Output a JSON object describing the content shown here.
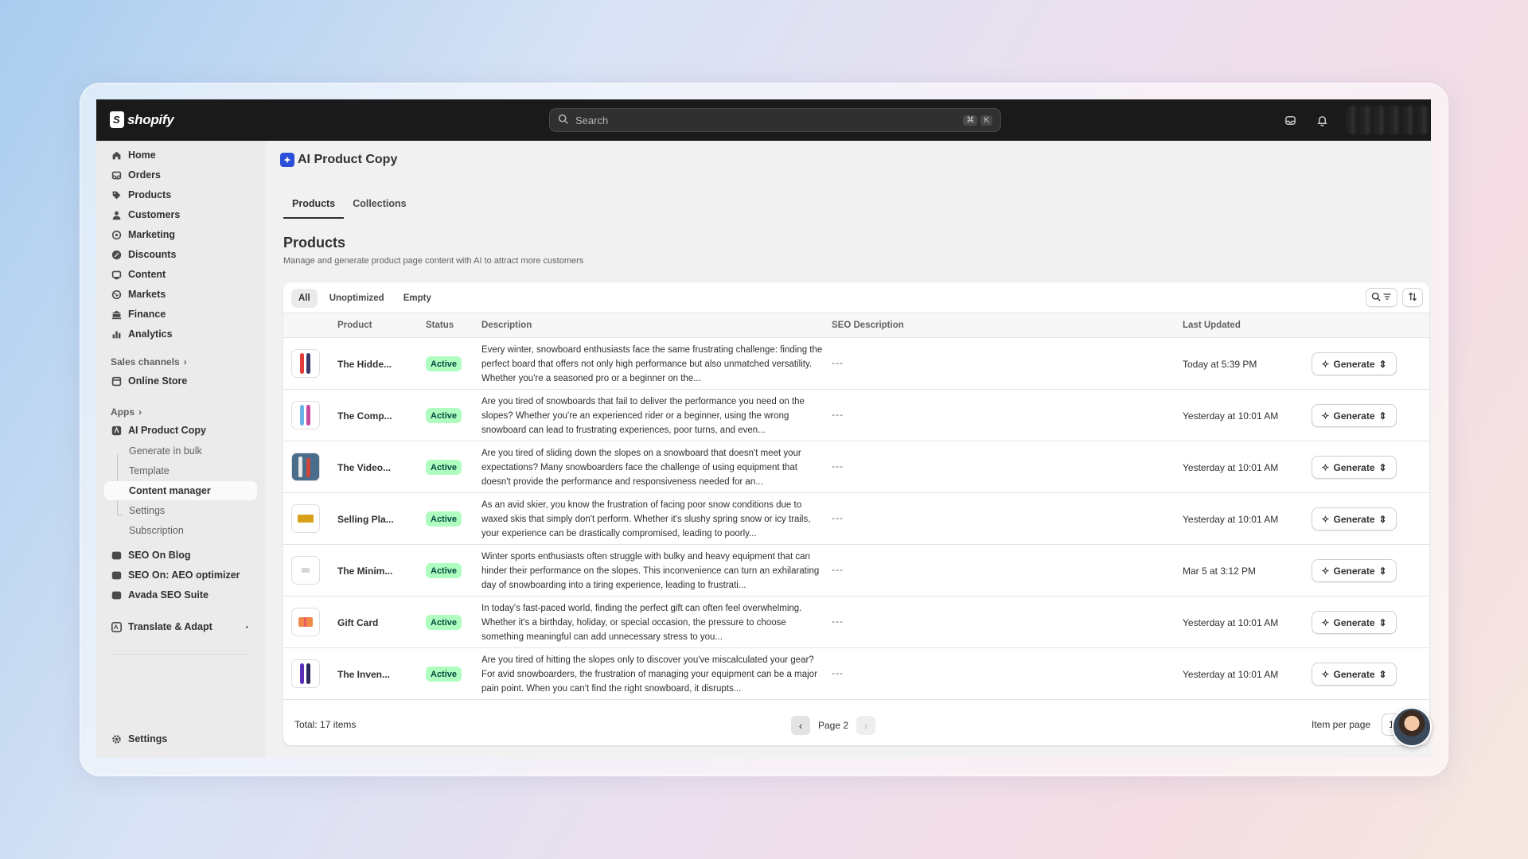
{
  "topbar": {
    "brand": "shopify",
    "search_placeholder": "Search",
    "shortcut_keys": [
      "⌘",
      "K"
    ]
  },
  "sidebar": {
    "items": [
      {
        "label": "Home",
        "icon": "home-icon"
      },
      {
        "label": "Orders",
        "icon": "orders-icon"
      },
      {
        "label": "Products",
        "icon": "tag-icon"
      },
      {
        "label": "Customers",
        "icon": "person-icon"
      },
      {
        "label": "Marketing",
        "icon": "target-icon"
      },
      {
        "label": "Discounts",
        "icon": "discount-icon"
      },
      {
        "label": "Content",
        "icon": "content-icon"
      },
      {
        "label": "Markets",
        "icon": "globe-icon"
      },
      {
        "label": "Finance",
        "icon": "bank-icon"
      },
      {
        "label": "Analytics",
        "icon": "bar-chart-icon"
      }
    ],
    "sales_channels_label": "Sales channels",
    "online_store": "Online Store",
    "apps_label": "Apps",
    "app_name": "AI Product Copy",
    "app_subitems": [
      "Generate in bulk",
      "Template",
      "Content manager",
      "Settings",
      "Subscription"
    ],
    "other_apps": [
      "SEO On Blog",
      "SEO On: AEO optimizer",
      "Avada SEO Suite"
    ],
    "translate_app": "Translate & Adapt",
    "settings": "Settings"
  },
  "main": {
    "app_title": "AI Product Copy",
    "tabs": [
      "Products",
      "Collections"
    ],
    "heading": "Products",
    "subheading": "Manage and generate product page content with AI to attract more customers",
    "filters": [
      "All",
      "Unoptimized",
      "Empty"
    ],
    "columns": {
      "product": "Product",
      "status": "Status",
      "description": "Description",
      "seo": "SEO Description",
      "updated": "Last Updated"
    },
    "rows": [
      {
        "name": "The Hidde...",
        "status": "Active",
        "description": "Every winter, snowboard enthusiasts face the same frustrating challenge: finding the perfect board that offers not only high performance but also unmatched versatility. Whether you're a seasoned pro or a beginner on the...",
        "seo": "---",
        "updated": "Today at 5:39 PM",
        "action": "Generate"
      },
      {
        "name": "The Comp...",
        "status": "Active",
        "description": "Are you tired of snowboards that fail to deliver the performance you need on the slopes? Whether you're an experienced rider or a beginner, using the wrong snowboard can lead to frustrating experiences, poor turns, and even...",
        "seo": "---",
        "updated": "Yesterday at 10:01 AM",
        "action": "Generate"
      },
      {
        "name": "The Video...",
        "status": "Active",
        "description": "Are you tired of sliding down the slopes on a snowboard that doesn't meet your expectations? Many snowboarders face the challenge of using equipment that doesn't provide the performance and responsiveness needed for an...",
        "seo": "---",
        "updated": "Yesterday at 10:01 AM",
        "action": "Generate"
      },
      {
        "name": "Selling Pla...",
        "status": "Active",
        "description": "As an avid skier, you know the frustration of facing poor snow conditions due to waxed skis that simply don't perform. Whether it's slushy spring snow or icy trails, your experience can be drastically compromised, leading to poorly...",
        "seo": "---",
        "updated": "Yesterday at 10:01 AM",
        "action": "Generate"
      },
      {
        "name": "The Minim...",
        "status": "Active",
        "description": "Winter sports enthusiasts often struggle with bulky and heavy equipment that can hinder their performance on the slopes. This inconvenience can turn an exhilarating day of snowboarding into a tiring experience, leading to frustrati...",
        "seo": "---",
        "updated": "Mar 5 at 3:12 PM",
        "action": "Generate"
      },
      {
        "name": "Gift Card",
        "status": "Active",
        "description": "In today's fast-paced world, finding the perfect gift can often feel overwhelming. Whether it's a birthday, holiday, or special occasion, the pressure to choose something meaningful can add unnecessary stress to you...",
        "seo": "---",
        "updated": "Yesterday at 10:01 AM",
        "action": "Generate"
      },
      {
        "name": "The Inven...",
        "status": "Active",
        "description": "Are you tired of hitting the slopes only to discover you've miscalculated your gear? For avid snowboarders, the frustration of managing your equipment can be a major pain point. When you can't find the right snowboard, it disrupts...",
        "seo": "---",
        "updated": "Yesterday at 10:01 AM",
        "action": "Generate"
      }
    ],
    "footer": {
      "total": "Total: 17 items",
      "page": "Page 2",
      "per_page_label": "Item per page",
      "per_page_value": "1"
    }
  },
  "colors": {
    "topbar": "#1a1a1a",
    "badge_bg": "#affebf",
    "badge_text": "#014b40",
    "app_logo": "#2b4fd8"
  }
}
